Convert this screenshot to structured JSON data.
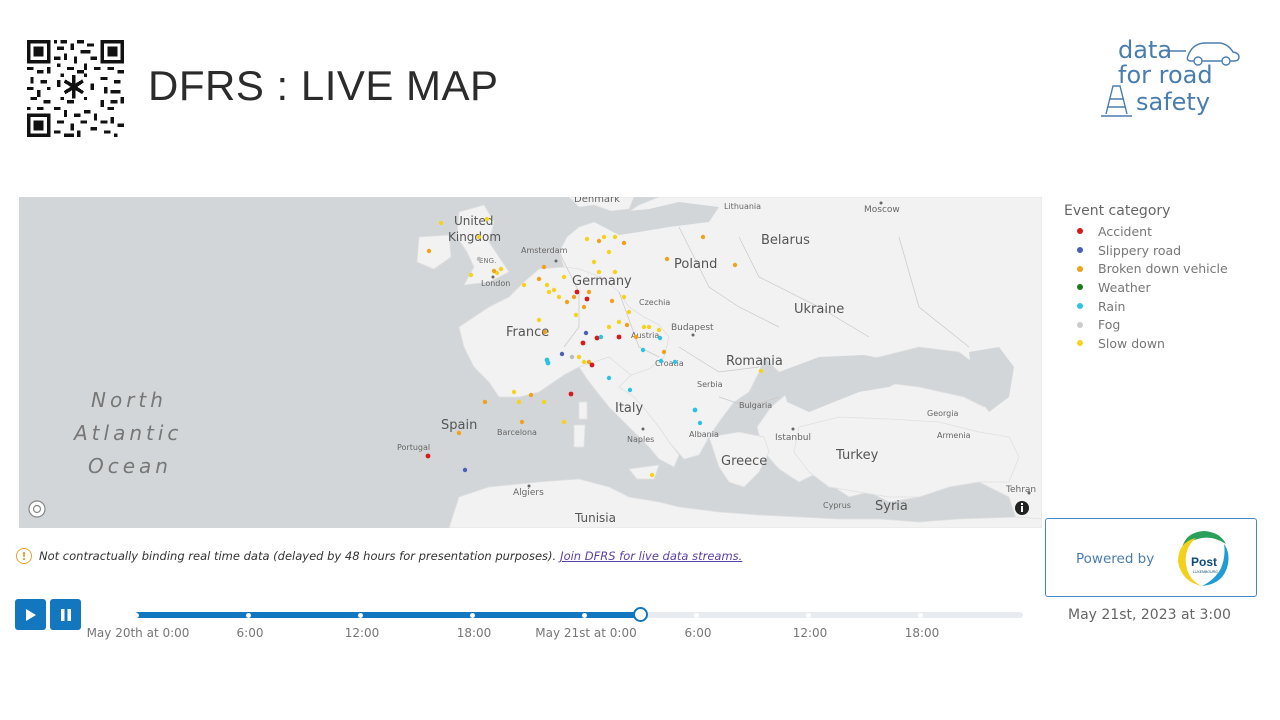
{
  "header": {
    "title": "DFRS : LIVE MAP",
    "qr_icon": "qr-code-icon"
  },
  "logo": {
    "line1": "data",
    "line2": "for road",
    "line3": "safety",
    "color": "#4a7daf"
  },
  "map": {
    "labels": {
      "north_atlantic": [
        "North",
        "Atlantic",
        "Ocean"
      ],
      "countries": [
        "United Kingdom",
        "Belarus",
        "Poland",
        "Germany",
        "Ukraine",
        "France",
        "Czechia",
        "Romania",
        "Spain",
        "Italy",
        "Turkey",
        "Greece",
        "Syria",
        "Tunisia",
        "Portugal",
        "Serbia",
        "Bulgaria",
        "Georgia",
        "Armenia",
        "Croatia",
        "Austria",
        "Albania",
        "Cyprus",
        "Lithuania"
      ],
      "cities": [
        "Moscow",
        "Amsterdam",
        "London",
        "Budapest",
        "Barcelona",
        "Naples",
        "Istanbul",
        "Algiers",
        "Tehran",
        "Denmark",
        "ENG."
      ]
    },
    "ocean_color": "#d3d6d8",
    "land_color": "#f2f2f2"
  },
  "legend": {
    "title": "Event category",
    "items": [
      {
        "label": "Accident",
        "color": "#d7191c"
      },
      {
        "label": "Slippery road",
        "color": "#4a5fb8"
      },
      {
        "label": "Broken down vehicle",
        "color": "#f0a21c"
      },
      {
        "label": "Weather",
        "color": "#1a7a1a"
      },
      {
        "label": "Rain",
        "color": "#2cc3e0"
      },
      {
        "label": "Fog",
        "color": "#cccccc"
      },
      {
        "label": "Slow down",
        "color": "#f5d21c"
      }
    ]
  },
  "notice": {
    "text": "Not contractually binding real time data (delayed by 48 hours for presentation purposes).",
    "link": "Join DFRS for live data streams."
  },
  "powered_by": {
    "label": "Powered by",
    "brand": "Post",
    "brand_sub": "LUXEMBOURG"
  },
  "timeline": {
    "current": "May 21st, 2023 at 3:00",
    "progress": 0.57,
    "ticks": [
      "May 20th at 0:00",
      "6:00",
      "12:00",
      "18:00",
      "May 21st at 0:00",
      "6:00",
      "12:00",
      "18:00"
    ],
    "accent": "#1277bf"
  },
  "controls": {
    "play_icon": "play-icon",
    "pause_icon": "pause-icon"
  }
}
